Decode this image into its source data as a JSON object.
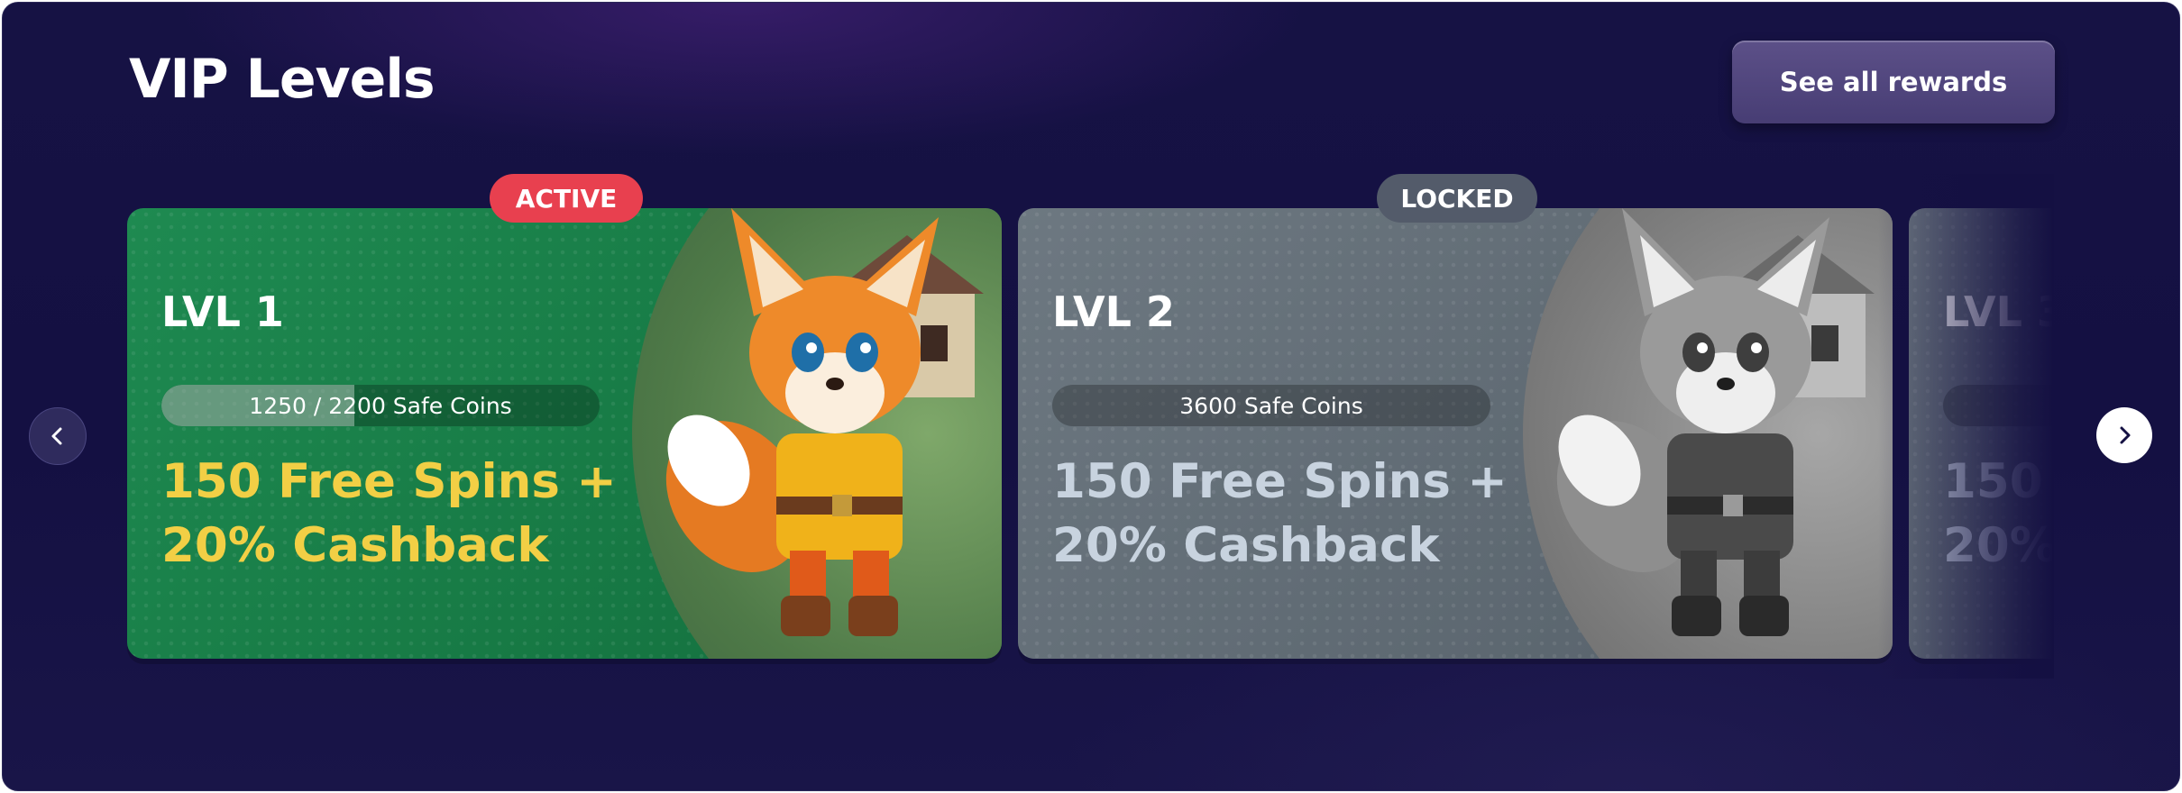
{
  "header": {
    "title": "VIP Levels",
    "see_all_label": "See all rewards"
  },
  "nav": {
    "prev_icon": "chevron-left-icon",
    "next_icon": "chevron-right-icon"
  },
  "colors": {
    "background": "#141042",
    "active_card": "#1a8049",
    "locked_card": "#66717a",
    "active_badge": "#e8404f",
    "locked_badge": "#535b6a",
    "active_reward_text": "#f2cf45",
    "locked_reward_text": "#c8d3df"
  },
  "levels": [
    {
      "badge": "ACTIVE",
      "level": "LVL 1",
      "progress_text": "1250 / 2200 Safe Coins",
      "progress_fraction": 0.44,
      "reward_line1": "150 Free Spins +",
      "reward_line2": "20% Cashback",
      "art": "fox-mascot-color"
    },
    {
      "badge": "LOCKED",
      "level": "LVL 2",
      "progress_text": "3600 Safe Coins",
      "progress_fraction": 0,
      "reward_line1": "150 Free Spins +",
      "reward_line2": "20% Cashback",
      "art": "fox-mascot-grayscale"
    },
    {
      "level": "LVL 3",
      "reward_line1": "150",
      "reward_line2": "20%"
    }
  ]
}
